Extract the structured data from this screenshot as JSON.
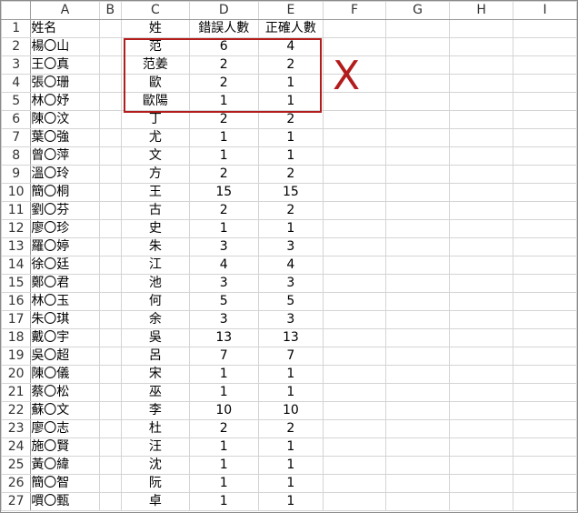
{
  "columns": [
    "A",
    "B",
    "C",
    "D",
    "E",
    "F",
    "G",
    "H",
    "I"
  ],
  "rows": [
    {
      "num": "1",
      "a": "姓名",
      "c": "姓",
      "d": "錯誤人數",
      "e": "正確人數"
    },
    {
      "num": "2",
      "a": "楊〇山",
      "c": "范",
      "d": "6",
      "e": "4"
    },
    {
      "num": "3",
      "a": "王〇真",
      "c": "范姜",
      "d": "2",
      "e": "2"
    },
    {
      "num": "4",
      "a": "張〇珊",
      "c": "歐",
      "d": "2",
      "e": "1"
    },
    {
      "num": "5",
      "a": "林〇妤",
      "c": "歐陽",
      "d": "1",
      "e": "1"
    },
    {
      "num": "6",
      "a": "陳〇汶",
      "c": "丁",
      "d": "2",
      "e": "2"
    },
    {
      "num": "7",
      "a": "葉〇強",
      "c": "尤",
      "d": "1",
      "e": "1"
    },
    {
      "num": "8",
      "a": "曾〇萍",
      "c": "文",
      "d": "1",
      "e": "1"
    },
    {
      "num": "9",
      "a": "溫〇玲",
      "c": "方",
      "d": "2",
      "e": "2"
    },
    {
      "num": "10",
      "a": "簡〇桐",
      "c": "王",
      "d": "15",
      "e": "15"
    },
    {
      "num": "11",
      "a": "劉〇芬",
      "c": "古",
      "d": "2",
      "e": "2"
    },
    {
      "num": "12",
      "a": "廖〇珍",
      "c": "史",
      "d": "1",
      "e": "1"
    },
    {
      "num": "13",
      "a": "羅〇婷",
      "c": "朱",
      "d": "3",
      "e": "3"
    },
    {
      "num": "14",
      "a": "徐〇廷",
      "c": "江",
      "d": "4",
      "e": "4"
    },
    {
      "num": "15",
      "a": "鄭〇君",
      "c": "池",
      "d": "3",
      "e": "3"
    },
    {
      "num": "16",
      "a": "林〇玉",
      "c": "何",
      "d": "5",
      "e": "5"
    },
    {
      "num": "17",
      "a": "朱〇琪",
      "c": "余",
      "d": "3",
      "e": "3"
    },
    {
      "num": "18",
      "a": "戴〇宇",
      "c": "吳",
      "d": "13",
      "e": "13"
    },
    {
      "num": "19",
      "a": "吳〇超",
      "c": "呂",
      "d": "7",
      "e": "7"
    },
    {
      "num": "20",
      "a": "陳〇儀",
      "c": "宋",
      "d": "1",
      "e": "1"
    },
    {
      "num": "21",
      "a": "蔡〇松",
      "c": "巫",
      "d": "1",
      "e": "1"
    },
    {
      "num": "22",
      "a": "蘇〇文",
      "c": "李",
      "d": "10",
      "e": "10"
    },
    {
      "num": "23",
      "a": "廖〇志",
      "c": "杜",
      "d": "2",
      "e": "2"
    },
    {
      "num": "24",
      "a": "施〇賢",
      "c": "汪",
      "d": "1",
      "e": "1"
    },
    {
      "num": "25",
      "a": "黃〇緯",
      "c": "沈",
      "d": "1",
      "e": "1"
    },
    {
      "num": "26",
      "a": "簡〇智",
      "c": "阮",
      "d": "1",
      "e": "1"
    },
    {
      "num": "27",
      "a": "嘪〇甄",
      "c": "卓",
      "d": "1",
      "e": "1"
    }
  ],
  "annotation": {
    "mark": "X",
    "color": "#b21c1c"
  }
}
